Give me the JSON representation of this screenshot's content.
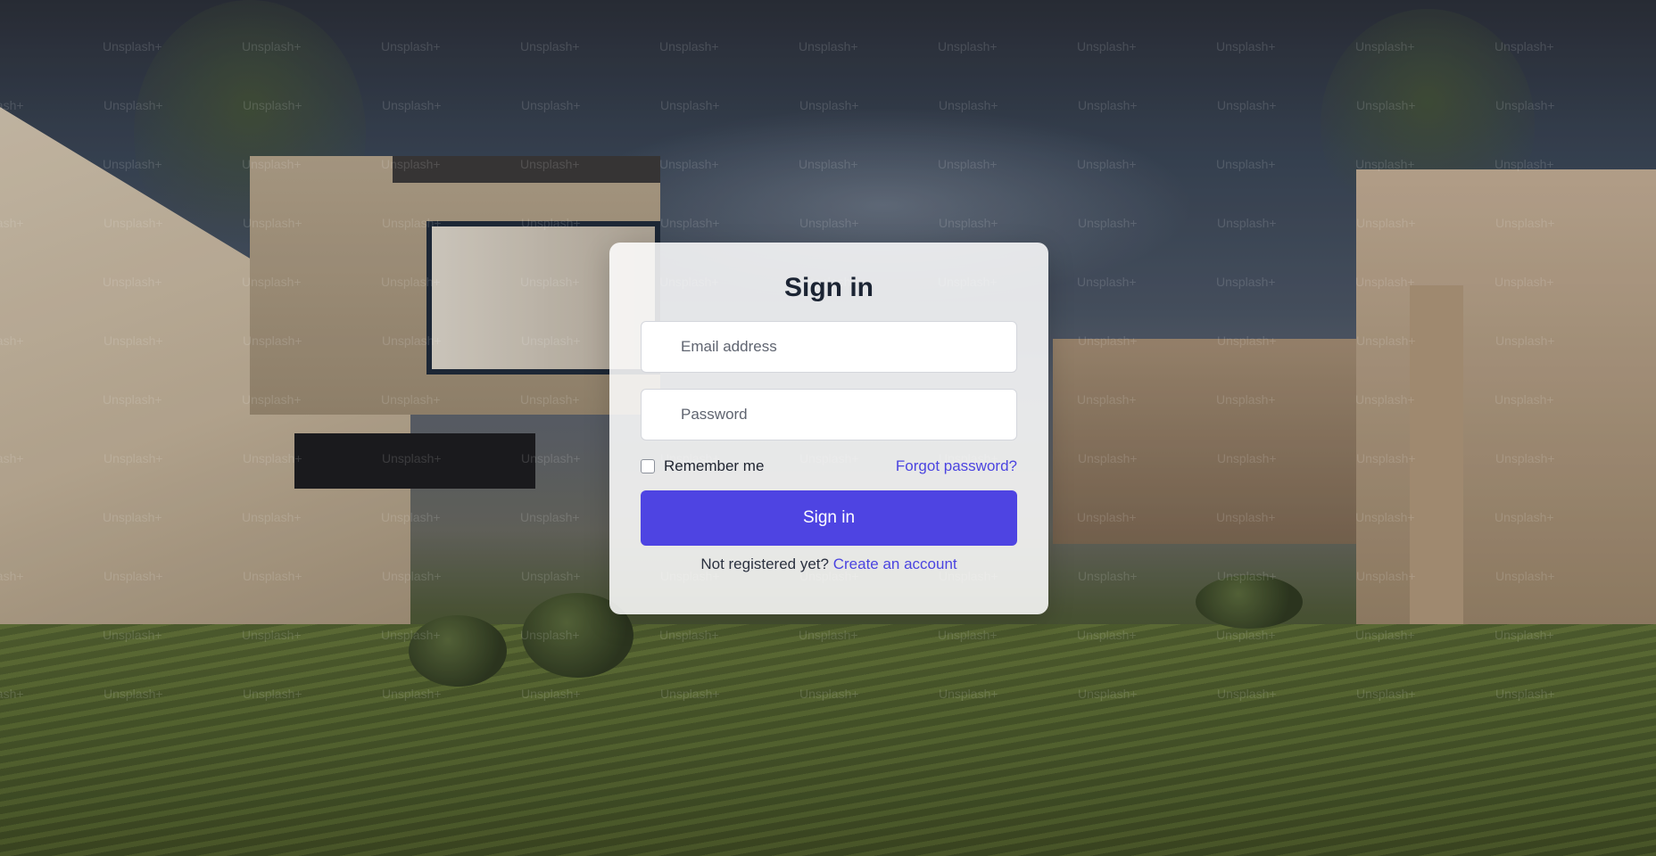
{
  "background": {
    "watermark_text": "Unsplash+"
  },
  "signin": {
    "title": "Sign in",
    "email_placeholder": "Email address",
    "email_value": "",
    "password_placeholder": "Password",
    "password_value": "",
    "remember_label": "Remember me",
    "remember_checked": false,
    "forgot_label": "Forgot password?",
    "submit_label": "Sign in",
    "register_prompt": "Not registered yet?",
    "register_link": "Create an account"
  },
  "colors": {
    "accent": "#4e44e2",
    "link": "#4b44e0",
    "card_bg": "rgba(255,255,255,0.86)",
    "title_text": "#1b2433"
  }
}
